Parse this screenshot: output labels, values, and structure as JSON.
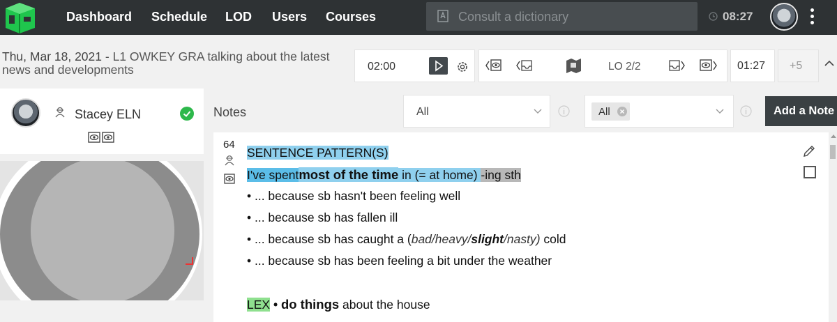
{
  "nav": {
    "items": [
      "Dashboard",
      "Schedule",
      "LOD",
      "Users",
      "Courses"
    ],
    "search_placeholder": "Consult a dictionary",
    "clock": "08:27",
    "logo_icon": "green-cube-logo-icon",
    "colors": {
      "topbar": "#2e3234",
      "logo": "#19c24a"
    }
  },
  "lesson": {
    "date": "Thu, Mar 18, 2021",
    "separator": " - ",
    "title": "L1 OWKEY GRA talking about the latest news and developments",
    "timer": "02:00",
    "lo_progress": "LO 2/2",
    "elapsed": "01:27",
    "extend": "+5"
  },
  "student": {
    "name": "Stacey ELN",
    "status_color": "#2db84b"
  },
  "notes": {
    "label": "Notes",
    "filter_value": "All",
    "tag_chip": "All",
    "add_button": "Add a Note"
  },
  "note": {
    "number": "64",
    "heading": "SENTENCE PATTERN(S)",
    "pattern": {
      "a": "I've spent",
      "b": "most of the time",
      "c": " in (= at home) ",
      "d": "-ing sth"
    },
    "bullets": [
      "• ... because sb hasn't been feeling well",
      "• ... because sb has fallen ill"
    ],
    "bullet3": {
      "pre": "• ... because sb has caught a (",
      "i1": "bad/heavy/",
      "b": "slight",
      "i2": "/nasty)",
      "post": " cold"
    },
    "bullet4": "• ... because sb has been feeling a bit under the weather",
    "lex": {
      "tag": "LEX",
      "dot": " • ",
      "bold": "do things",
      "rest": " about the house"
    },
    "highlight_colors": {
      "heading": "#8fd0ee",
      "spent": "#5bbde8",
      "ing": "#b8b8b8",
      "lex": "#8fe08f"
    }
  }
}
